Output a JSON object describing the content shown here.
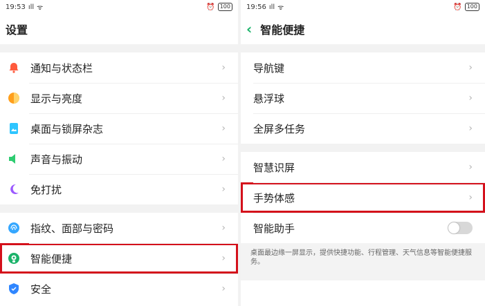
{
  "left": {
    "status": {
      "time": "19:53",
      "battery": "100"
    },
    "title": "设置",
    "groups": [
      {
        "items": [
          {
            "label": "通知与状态栏",
            "icon": "bell-icon",
            "color": "#ff5a3d"
          },
          {
            "label": "显示与亮度",
            "icon": "brightness-icon",
            "color": "#ff9f1c"
          },
          {
            "label": "桌面与锁屏杂志",
            "icon": "wallpaper-icon",
            "color": "#2ec5ff"
          },
          {
            "label": "声音与振动",
            "icon": "speaker-icon",
            "color": "#2ecc71"
          },
          {
            "label": "免打扰",
            "icon": "moon-icon",
            "color": "#9b59ff"
          }
        ]
      },
      {
        "items": [
          {
            "label": "指纹、面部与密码",
            "icon": "fingerprint-icon",
            "color": "#35a7ff"
          },
          {
            "label": "智能便捷",
            "icon": "smart-assist-icon",
            "color": "#1bb36a",
            "highlighted": true
          },
          {
            "label": "安全",
            "icon": "shield-icon",
            "color": "#2f86ff"
          }
        ]
      }
    ]
  },
  "right": {
    "status": {
      "time": "19:56",
      "battery": "100"
    },
    "title": "智能便捷",
    "groups": [
      {
        "items": [
          {
            "label": "导航键"
          },
          {
            "label": "悬浮球"
          },
          {
            "label": "全屏多任务"
          }
        ]
      },
      {
        "items": [
          {
            "label": "智慧识屏"
          },
          {
            "label": "手势体感",
            "highlighted": true
          },
          {
            "label": "智能助手",
            "toggle": true,
            "toggle_on": false
          }
        ]
      }
    ],
    "note": "桌面最边缘一屏显示，提供快捷功能、行程管理、天气信息等智能便捷服务。"
  },
  "glyphs": {
    "chevron": "›",
    "back": "‹",
    "signal": "ıll",
    "wifi": "ᯤ"
  },
  "colors": {
    "accent": "#1bb36a",
    "highlight": "#d4101b"
  }
}
